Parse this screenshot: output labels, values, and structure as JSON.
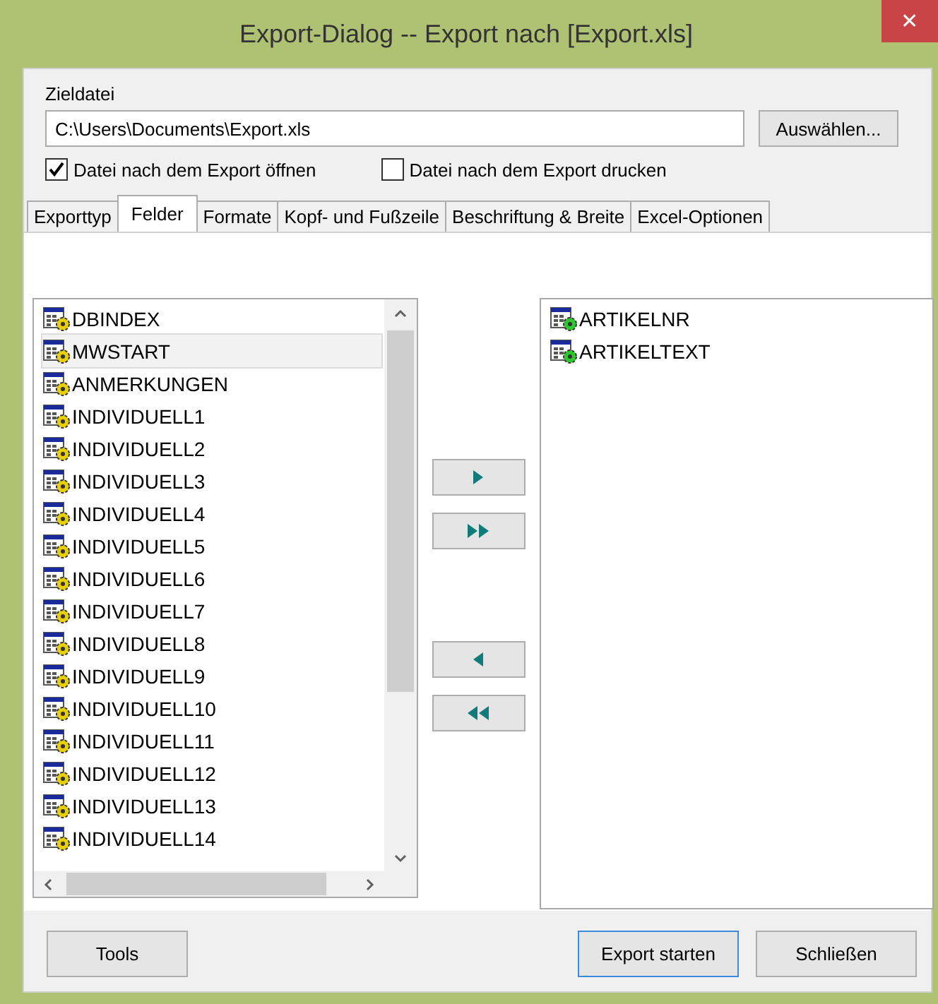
{
  "window": {
    "title": "Export-Dialog -- Export nach [Export.xls]",
    "close": "✕"
  },
  "target": {
    "label": "Zieldatei",
    "value": "C:\\Users\\Documents\\Export.xls",
    "browse": "Auswählen..."
  },
  "options": [
    {
      "label": "Datei nach dem Export öffnen",
      "checked": true
    },
    {
      "label": "Datei nach dem Export drucken",
      "checked": false
    }
  ],
  "tabs": [
    {
      "label": "Exporttyp",
      "selected": false
    },
    {
      "label": "Felder",
      "selected": true
    },
    {
      "label": "Formate",
      "selected": false
    },
    {
      "label": "Kopf- und Fußzeile",
      "selected": false
    },
    {
      "label": "Beschriftung & Breite",
      "selected": false
    },
    {
      "label": "Excel-Optionen",
      "selected": false
    }
  ],
  "available_fields": [
    {
      "label": "DBINDEX",
      "selected": false
    },
    {
      "label": "MWSTART",
      "selected": true
    },
    {
      "label": "ANMERKUNGEN",
      "selected": false
    },
    {
      "label": "INDIVIDUELL1",
      "selected": false
    },
    {
      "label": "INDIVIDUELL2",
      "selected": false
    },
    {
      "label": "INDIVIDUELL3",
      "selected": false
    },
    {
      "label": "INDIVIDUELL4",
      "selected": false
    },
    {
      "label": "INDIVIDUELL5",
      "selected": false
    },
    {
      "label": "INDIVIDUELL6",
      "selected": false
    },
    {
      "label": "INDIVIDUELL7",
      "selected": false
    },
    {
      "label": "INDIVIDUELL8",
      "selected": false
    },
    {
      "label": "INDIVIDUELL9",
      "selected": false
    },
    {
      "label": "INDIVIDUELL10",
      "selected": false
    },
    {
      "label": "INDIVIDUELL11",
      "selected": false
    },
    {
      "label": "INDIVIDUELL12",
      "selected": false
    },
    {
      "label": "INDIVIDUELL13",
      "selected": false
    },
    {
      "label": "INDIVIDUELL14",
      "selected": false
    }
  ],
  "selected_fields": [
    {
      "label": "ARTIKELNR",
      "selected": false
    },
    {
      "label": "ARTIKELTEXT",
      "selected": false
    }
  ],
  "buttons": [
    {
      "label": "Tools",
      "kind": "left"
    },
    {
      "label": "Export starten",
      "kind": "default"
    },
    {
      "label": "Schließen",
      "kind": "normal"
    }
  ]
}
